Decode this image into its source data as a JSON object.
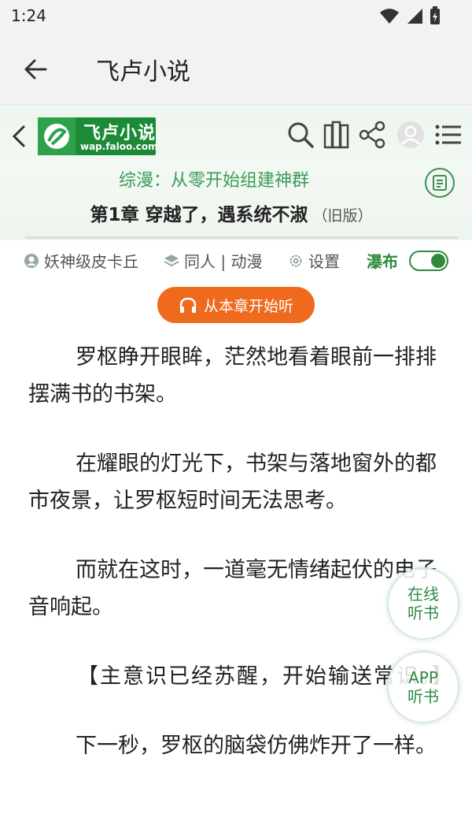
{
  "status_bar": {
    "time": "1:24"
  },
  "app_bar": {
    "title": "飞卢小说"
  },
  "site_header": {
    "logo_name": "飞卢小说",
    "logo_url": "wap.faloo.com",
    "book_title": "综漫：从零开始组建神群",
    "chapter_title": "第1章 穿越了，遇系统不淑",
    "chapter_note": "（旧版）"
  },
  "meta": {
    "author": "妖神级皮卡丘",
    "category": "同人 | 动漫",
    "settings_label": "设置",
    "waterfall_label": "瀑布",
    "waterfall_on": true
  },
  "listen_button": "从本章开始听",
  "content": {
    "paragraphs": [
      "罗枢睁开眼眸，茫然地看着眼前一排排摆满书的书架。",
      "在耀眼的灯光下，书架与落地窗外的都市夜景，让罗枢短时间无法思考。",
      "而就在这时，一道毫无情绪起伏的电子音响起。",
      "【主意识已经苏醒，开始输送常识。】",
      "下一秒，罗枢的脑袋仿佛炸开了一样。"
    ]
  },
  "float_buttons": {
    "online_listen": "在线\n听书",
    "app_listen": "APP\n听书"
  },
  "colors": {
    "accent_green": "#2f8a3e",
    "orange": "#f06a1e"
  }
}
